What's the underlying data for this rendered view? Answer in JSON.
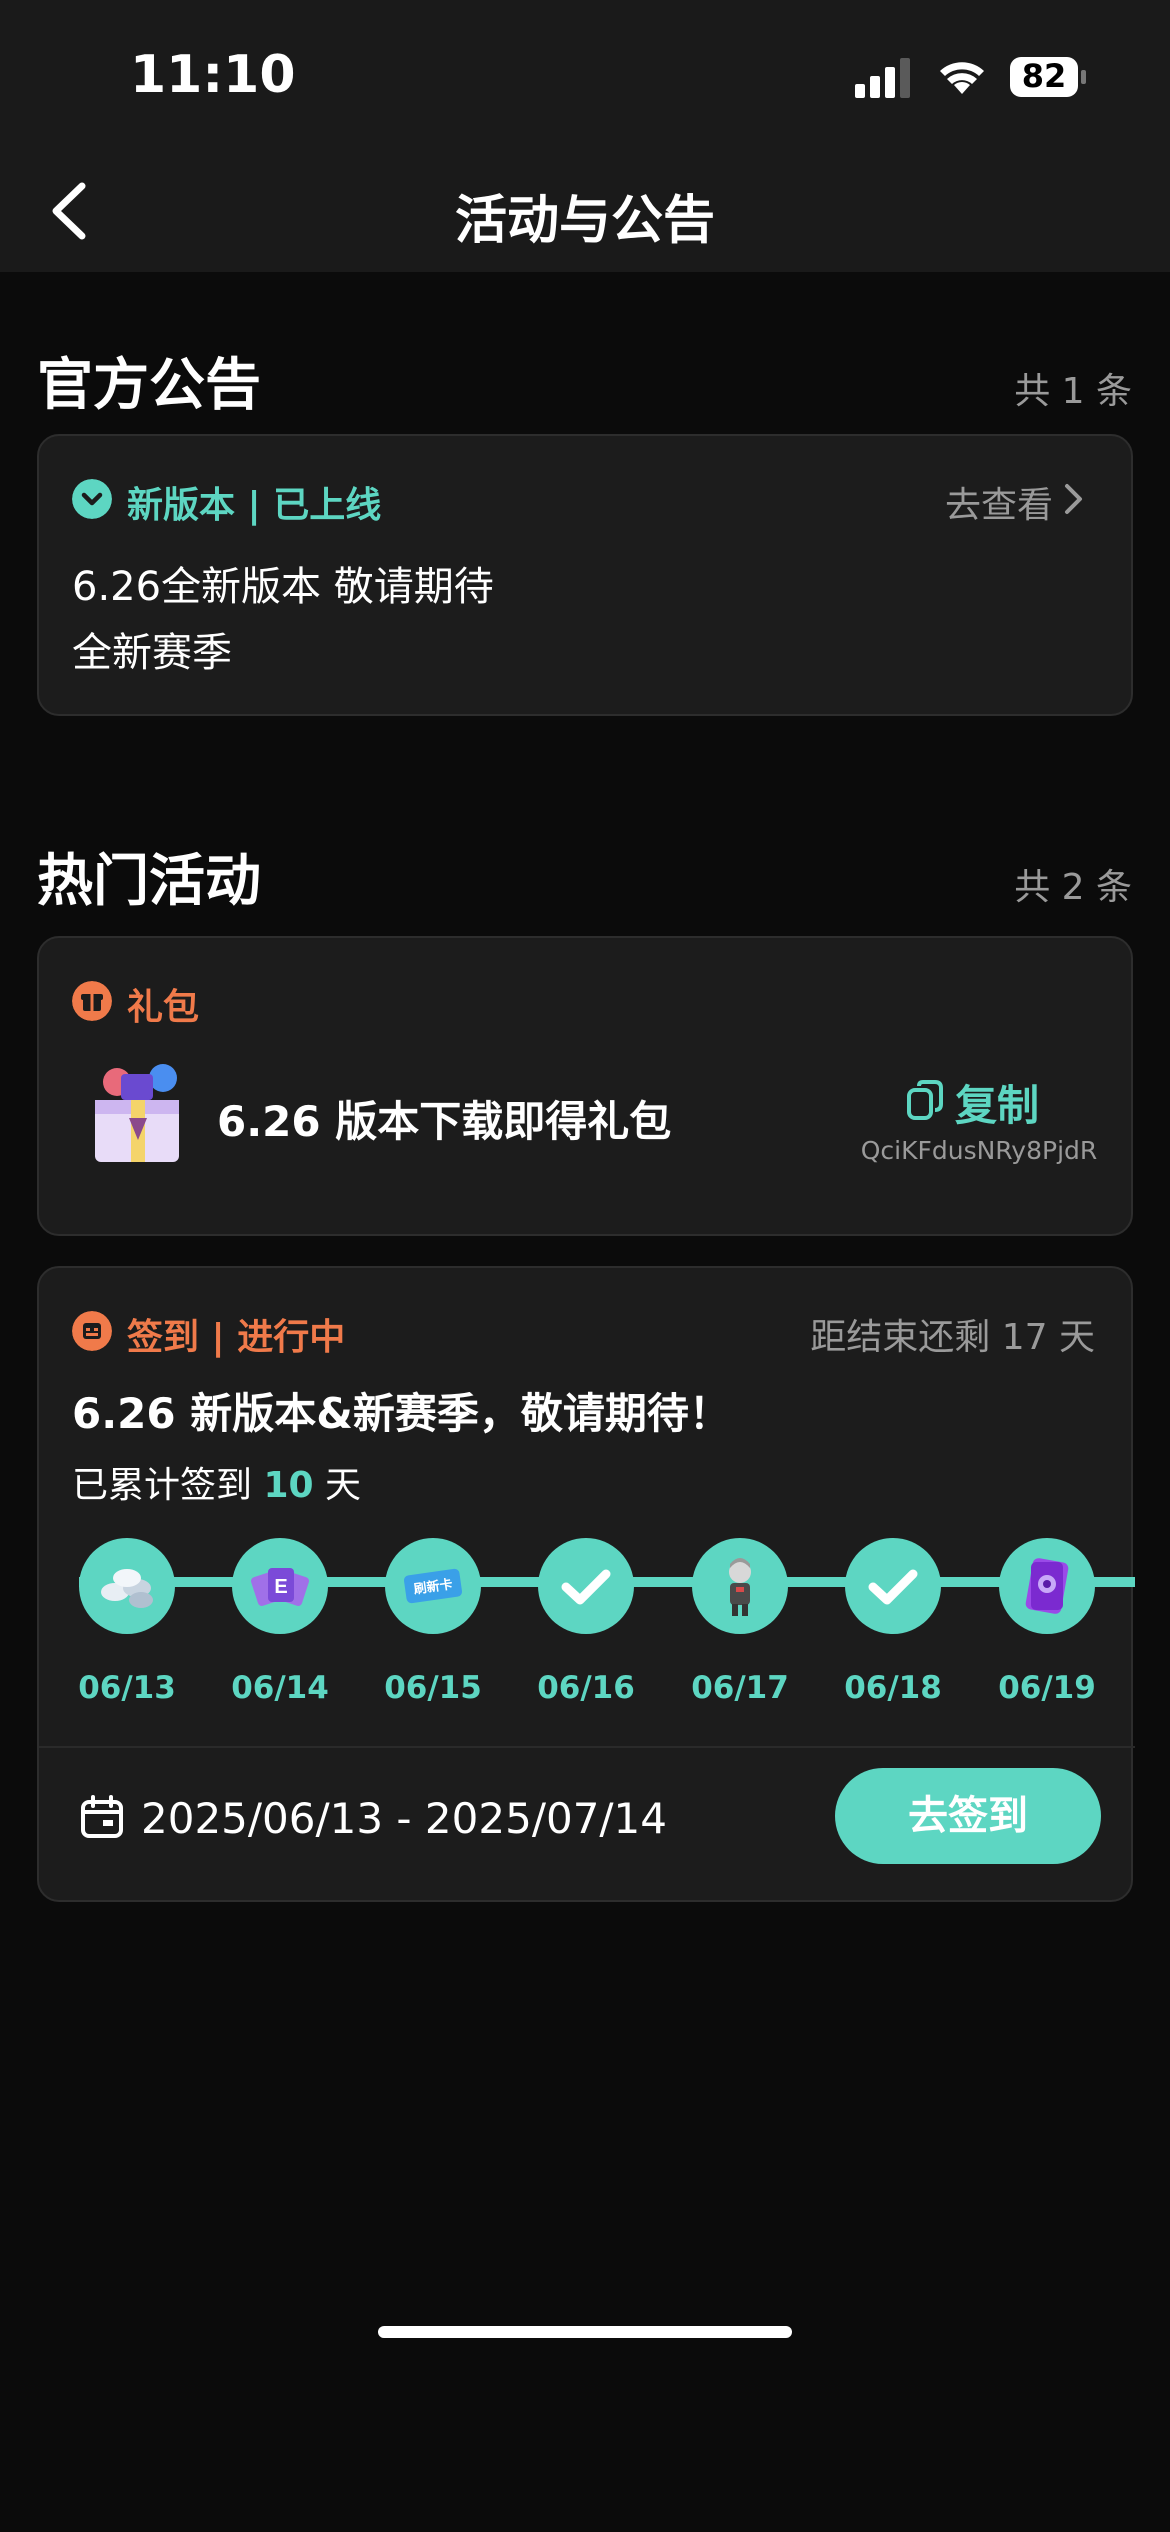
{
  "status_bar": {
    "time": "11:10",
    "battery": "82"
  },
  "nav": {
    "title": "活动与公告"
  },
  "announcements": {
    "title": "官方公告",
    "count": "共 1 条",
    "card": {
      "tag": "新版本 | 已上线",
      "link": "去查看",
      "line1": "6.26全新版本 敬请期待",
      "line2": "全新赛季"
    }
  },
  "hot_events": {
    "title": "热门活动",
    "count": "共 2 条",
    "gift": {
      "tag": "礼包",
      "title": "6.26 版本下载即得礼包",
      "copy_label": "复制",
      "code": "QciKFdusNRy8PjdR"
    },
    "checkin": {
      "tag": "签到 | 进行中",
      "remaining": "距结束还剩 17 天",
      "title": "6.26 新版本&新赛季，敬请期待！",
      "progress_prefix": "已累计签到",
      "progress_days": "10",
      "progress_suffix": "天",
      "days": [
        {
          "date": "06/13",
          "icon": "coins-icon"
        },
        {
          "date": "06/14",
          "icon": "cards-icon"
        },
        {
          "date": "06/15",
          "icon": "ticket-icon"
        },
        {
          "date": "06/16",
          "icon": "check-icon"
        },
        {
          "date": "06/17",
          "icon": "character-icon"
        },
        {
          "date": "06/18",
          "icon": "check-icon"
        },
        {
          "date": "06/19",
          "icon": "card-pack-icon"
        }
      ],
      "ticket_text": "刷新卡",
      "date_range": "2025/06/13 - 2025/07/14",
      "button_label": "去签到"
    }
  },
  "colors": {
    "accent": "#5dd6c2",
    "orange": "#f07a4a",
    "background": "#0b0b0b",
    "card": "#1c1c1c"
  }
}
